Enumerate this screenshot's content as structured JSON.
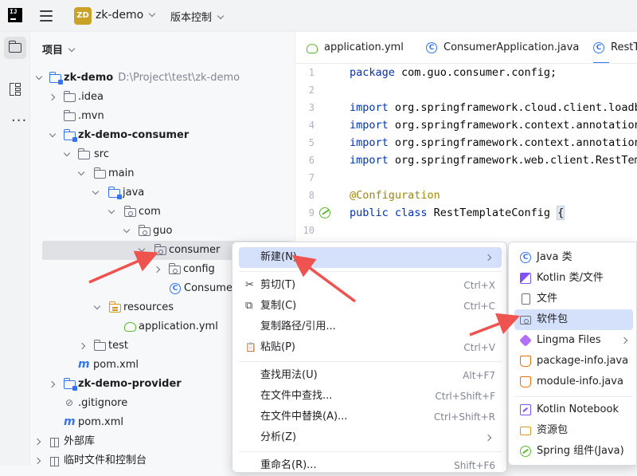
{
  "titlebar": {
    "logo": "IJ",
    "project_badge": "ZD",
    "project_name": "zk-demo",
    "vcs_label": "版本控制"
  },
  "toolstrip": {
    "items": [
      "folder-icon",
      "structure-icon",
      "more-icon"
    ]
  },
  "project_panel": {
    "title": "项目",
    "tree": [
      {
        "label": "zk-demo",
        "path": "D:\\Project\\test\\zk-demo"
      },
      {
        "label": ".idea"
      },
      {
        "label": ".mvn"
      },
      {
        "label": "zk-demo-consumer"
      },
      {
        "label": "src"
      },
      {
        "label": "main"
      },
      {
        "label": "java"
      },
      {
        "label": "com"
      },
      {
        "label": "guo"
      },
      {
        "label": "consumer"
      },
      {
        "label": "config"
      },
      {
        "label": "Consumer"
      },
      {
        "label": "resources"
      },
      {
        "label": "application.yml"
      },
      {
        "label": "test"
      },
      {
        "label": "pom.xml"
      },
      {
        "label": "zk-demo-provider"
      },
      {
        "label": ".gitignore"
      },
      {
        "label": "pom.xml"
      },
      {
        "label": "外部库"
      },
      {
        "label": "临时文件和控制台"
      }
    ]
  },
  "editor": {
    "tabs": [
      {
        "label": "application.yml",
        "icon": "yml-icon"
      },
      {
        "label": "ConsumerApplication.java",
        "icon": "class-icon"
      },
      {
        "label": "RestT",
        "icon": "class-icon"
      }
    ],
    "class_glyph": "C",
    "line_numbers": [
      "1",
      "2",
      "3",
      "4",
      "5",
      "6",
      "7",
      "8",
      "9",
      "10"
    ],
    "lines": {
      "l1_kw": "package",
      "l1_rest": " com.guo.consumer.config;",
      "l3_kw": "import",
      "l3_rest": " org.springframework.cloud.client.loadba",
      "l4_kw": "import",
      "l4_rest": " org.springframework.context.annotation",
      "l5_kw": "import",
      "l5_rest": " org.springframework.context.annotation",
      "l6_kw": "import",
      "l6_rest": " org.springframework.web.client.RestTemp",
      "l8_ann": "@Configuration",
      "l9_kw": "public class",
      "l9_rest": " RestTemplateConfig ",
      "l9_brace": "{"
    }
  },
  "context_menu": {
    "items": [
      {
        "label": "新建(N)",
        "shortcut": ""
      },
      {
        "label": "剪切(T)",
        "shortcut": "Ctrl+X",
        "glyph": "✂"
      },
      {
        "label": "复制(C)",
        "shortcut": "Ctrl+C",
        "glyph": "⧉"
      },
      {
        "label": "复制路径/引用...",
        "shortcut": ""
      },
      {
        "label": "粘贴(P)",
        "shortcut": "Ctrl+V",
        "glyph": "📋"
      },
      {
        "label": "查找用法(U)",
        "shortcut": "Alt+F7"
      },
      {
        "label": "在文件中查找...",
        "shortcut": "Ctrl+Shift+F"
      },
      {
        "label": "在文件中替换(A)...",
        "shortcut": "Ctrl+Shift+R"
      },
      {
        "label": "分析(Z)",
        "shortcut": ""
      },
      {
        "label": "重命名(R)...",
        "shortcut": "Shift+F6"
      }
    ]
  },
  "submenu": {
    "items": [
      {
        "label": "Java 类",
        "icon": "java-class-icon"
      },
      {
        "label": "Kotlin 类/文件",
        "icon": "kotlin-icon"
      },
      {
        "label": "文件",
        "icon": "file-icon"
      },
      {
        "label": "软件包",
        "icon": "package-icon"
      },
      {
        "label": "Lingma Files",
        "icon": "lingma-icon"
      },
      {
        "label": "package-info.java",
        "icon": "java-file-icon"
      },
      {
        "label": "module-info.java",
        "icon": "java-file-icon"
      },
      {
        "label": "Kotlin Notebook",
        "icon": "notebook-icon"
      },
      {
        "label": "资源包",
        "icon": "resource-bundle-icon"
      },
      {
        "label": "Spring 组件(Java)",
        "icon": "spring-icon"
      }
    ]
  },
  "colors": {
    "accent": "#3574f0",
    "annotation_arrow": "#ef5350",
    "highlight": "#d5e1fb",
    "selection": "#dfe1e5"
  }
}
